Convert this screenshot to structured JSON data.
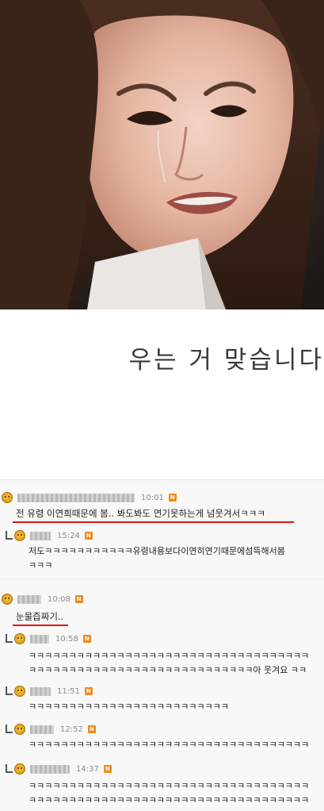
{
  "caption": "우는 거 맞습니다",
  "comments": [
    {
      "time": "10:01",
      "new_badge": "N",
      "text": "전 유령 이연희때문에 봄.. 봐도봐도 연기못하는게 넘웃겨서ㅋㅋㅋ",
      "reply": false
    },
    {
      "time": "15:24",
      "new_badge": "N",
      "text": "저도ㅋㅋㅋㅋㅋㅋㅋㅋㅋㅋㅋ유령내용보다이연히연기때문에섬뜩해서봄",
      "text2": "ㅋㅋㅋ",
      "reply": true
    },
    {
      "time": "10:08",
      "new_badge": "N",
      "text": "눈물즙짜기..",
      "reply": false
    },
    {
      "time": "10:58",
      "new_badge": "N",
      "text": "ㅋㅋㅋㅋㅋㅋㅋㅋㅋㅋㅋㅋㅋㅋㅋㅋㅋㅋㅋㅋㅋㅋㅋㅋㅋㅋㅋㅋㅋㅋㅋㅋㅋㅋㅋ",
      "text2": "ㅋㅋㅋㅋㅋㅋㅋㅋㅋㅋㅋㅋㅋㅋㅋㅋㅋㅋㅋㅋㅋㅋㅋㅋㅋㅋㅋㅋ아 웃겨요 ㅋㅋ",
      "reply": true
    },
    {
      "time": "11:51",
      "new_badge": "N",
      "text": "ㅋㅋㅋㅋㅋㅋㅋㅋㅋㅋㅋㅋㅋㅋㅋㅋㅋㅋㅋㅋㅋㅋㅋㅋㅋ",
      "reply": true
    },
    {
      "time": "12:52",
      "new_badge": "N",
      "text": "ㅋㅋㅋㅋㅋㅋㅋㅋㅋㅋㅋㅋㅋㅋㅋㅋㅋㅋㅋㅋㅋㅋㅋㅋㅋㅋㅋㅋㅋㅋㅋㅋㅋㅋㅋ",
      "reply": true
    },
    {
      "time": "14:37",
      "new_badge": "N",
      "text": "ㅋㅋㅋㅋㅋㅋㅋㅋㅋㅋㅋㅋㅋㅋㅋㅋㅋㅋㅋㅋㅋㅋㅋㅋㅋㅋㅋㅋㅋㅋㅋㅋㅋㅋㅋ",
      "text2": "ㅋㅋㅋㅋㅋㅋㅋㅋㅋㅋㅋㅋㅋㅋㅋㅋㅋㅋㅋㅋㅋㅋㅋㅋㅋㅋㅋㅋㅋㅋㅋㅋㅋㅋㅋ",
      "reply": true
    }
  ],
  "colors": {
    "highlight_underline": "#e01515",
    "new_badge": "#f08a1c",
    "avatar": "#e0a019"
  }
}
